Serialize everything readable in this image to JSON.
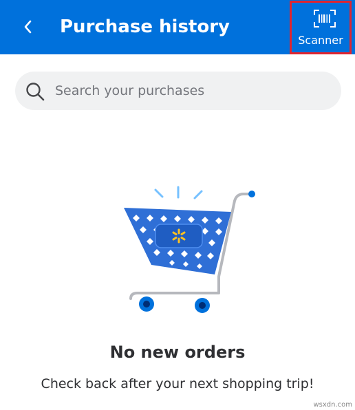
{
  "header": {
    "title": "Purchase history",
    "back_icon": "chevron-left-icon",
    "scanner_label": "Scanner",
    "scanner_icon": "barcode-scanner-icon",
    "background_color": "#0071dc",
    "highlight_color": "#e0242f"
  },
  "search": {
    "placeholder": "Search your purchases",
    "value": "",
    "icon": "search-icon"
  },
  "empty_state": {
    "illustration": "shopping-cart-icon",
    "title": "No new orders",
    "subtitle": "Check back after your next shopping trip!"
  },
  "watermark": "wsxdn.com"
}
